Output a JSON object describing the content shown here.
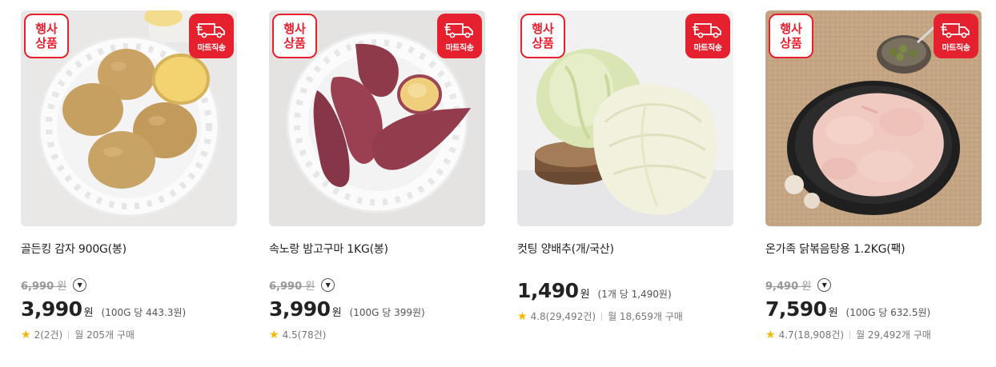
{
  "colors": {
    "accent": "#e5202f",
    "star": "#f5b800"
  },
  "badges": {
    "event_line1": "행사",
    "event_line2": "상품",
    "ship_label": "마트직송",
    "ship_icon": "delivery-truck-icon"
  },
  "products": [
    {
      "name": "골든킹 감자 900G(봉)",
      "original_price": "6,990",
      "original_unit": "원",
      "price": "3,990",
      "price_unit": "원",
      "unit_price": "(100G 당 443.3원)",
      "rating": "2",
      "reviews": "(2건)",
      "monthly_sales": "월 205개 구매",
      "image": "potato"
    },
    {
      "name": "속노랑 밤고구마 1KG(봉)",
      "original_price": "6,990",
      "original_unit": "원",
      "price": "3,990",
      "price_unit": "원",
      "unit_price": "(100G 당 399원)",
      "rating": "4.5",
      "reviews": "(78건)",
      "monthly_sales": "",
      "image": "sweet-potato"
    },
    {
      "name": "컷팅 양배추(개/국산)",
      "original_price": "",
      "original_unit": "",
      "price": "1,490",
      "price_unit": "원",
      "unit_price": "(1개 당 1,490원)",
      "rating": "4.8",
      "reviews": "(29,492건)",
      "monthly_sales": "월 18,659개 구매",
      "image": "cabbage"
    },
    {
      "name": "온가족 닭볶음탕용 1.2KG(팩)",
      "original_price": "9,490",
      "original_unit": "원",
      "price": "7,590",
      "price_unit": "원",
      "unit_price": "(100G 당 632.5원)",
      "rating": "4.7",
      "reviews": "(18,908건)",
      "monthly_sales": "월 29,492개 구매",
      "image": "chicken"
    }
  ]
}
